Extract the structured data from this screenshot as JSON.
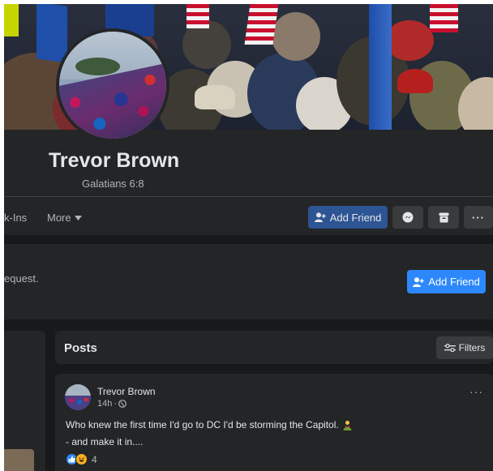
{
  "profile": {
    "name": "Trevor Brown",
    "bio": "Galatians 6:8"
  },
  "tabs": {
    "partial_tab": "k-Ins",
    "more_label": "More"
  },
  "actions": {
    "add_friend_label": "Add Friend",
    "request_text": "equest.",
    "request_button_label": "Add Friend"
  },
  "posts_section": {
    "title": "Posts",
    "filters_label": "Filters"
  },
  "post": {
    "author": "Trevor Brown",
    "time": "14h",
    "separator": "·",
    "line1": "Who knew the first time I'd go to DC I'd be storming the Capitol.",
    "line2": "- and make it in....",
    "reaction_count": "4",
    "more_label": "···"
  },
  "colors": {
    "accent": "#2d88ff",
    "background": "#18191a",
    "card": "#242526"
  }
}
